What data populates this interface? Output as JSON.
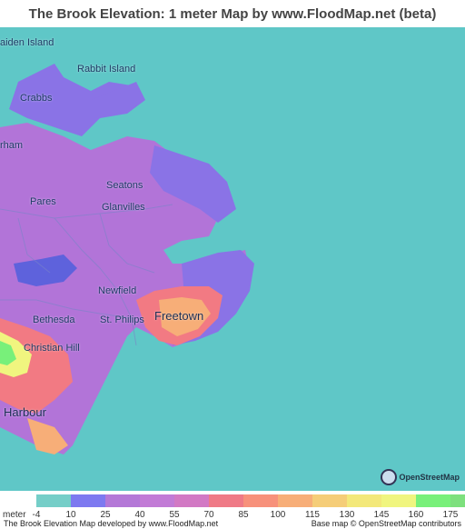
{
  "title": "The Brook Elevation: 1 meter Map by www.FloodMap.net (beta)",
  "map": {
    "labels": [
      {
        "id": "maiden-island",
        "text": "aiden Island",
        "big": false
      },
      {
        "id": "rabbit-island",
        "text": "Rabbit Island",
        "big": false
      },
      {
        "id": "crabbs",
        "text": "Crabbs",
        "big": false
      },
      {
        "id": "parham",
        "text": "rham",
        "big": false
      },
      {
        "id": "seatons",
        "text": "Seatons",
        "big": false
      },
      {
        "id": "pares",
        "text": "Pares",
        "big": false
      },
      {
        "id": "glanvilles",
        "text": "Glanvilles",
        "big": false
      },
      {
        "id": "newfield",
        "text": "Newfield",
        "big": false
      },
      {
        "id": "bethesda",
        "text": "Bethesda",
        "big": false
      },
      {
        "id": "st-philips",
        "text": "St. Philips",
        "big": false
      },
      {
        "id": "freetown",
        "text": "Freetown",
        "big": true
      },
      {
        "id": "christian-hill",
        "text": "Christian Hill",
        "big": false
      },
      {
        "id": "harbour",
        "text": "Harbour",
        "big": true
      }
    ],
    "osm_badge_text": "OpenStreetMap",
    "osm_badge_icon": "openstreetmap-logo-icon",
    "colors": {
      "sea": "#5fc7c7",
      "low": "#8a73e6",
      "mid": "#c479d2",
      "high": "#f27a83"
    }
  },
  "legend": {
    "unit": "meter",
    "ticks": [
      "-4",
      "10",
      "25",
      "40",
      "55",
      "70",
      "85",
      "100",
      "115",
      "130",
      "145",
      "160",
      "175"
    ],
    "colors": [
      "#75cec8",
      "#7d79f0",
      "#b478d7",
      "#c27bd6",
      "#d279c4",
      "#ef7a86",
      "#f7917b",
      "#f7ae78",
      "#f5cd78",
      "#f3e87a",
      "#f0f57f",
      "#78f07a",
      "#7de07d"
    ]
  },
  "footer": {
    "left": "The Brook Elevation Map developed by www.FloodMap.net",
    "right": "Base map © OpenStreetMap contributors"
  }
}
